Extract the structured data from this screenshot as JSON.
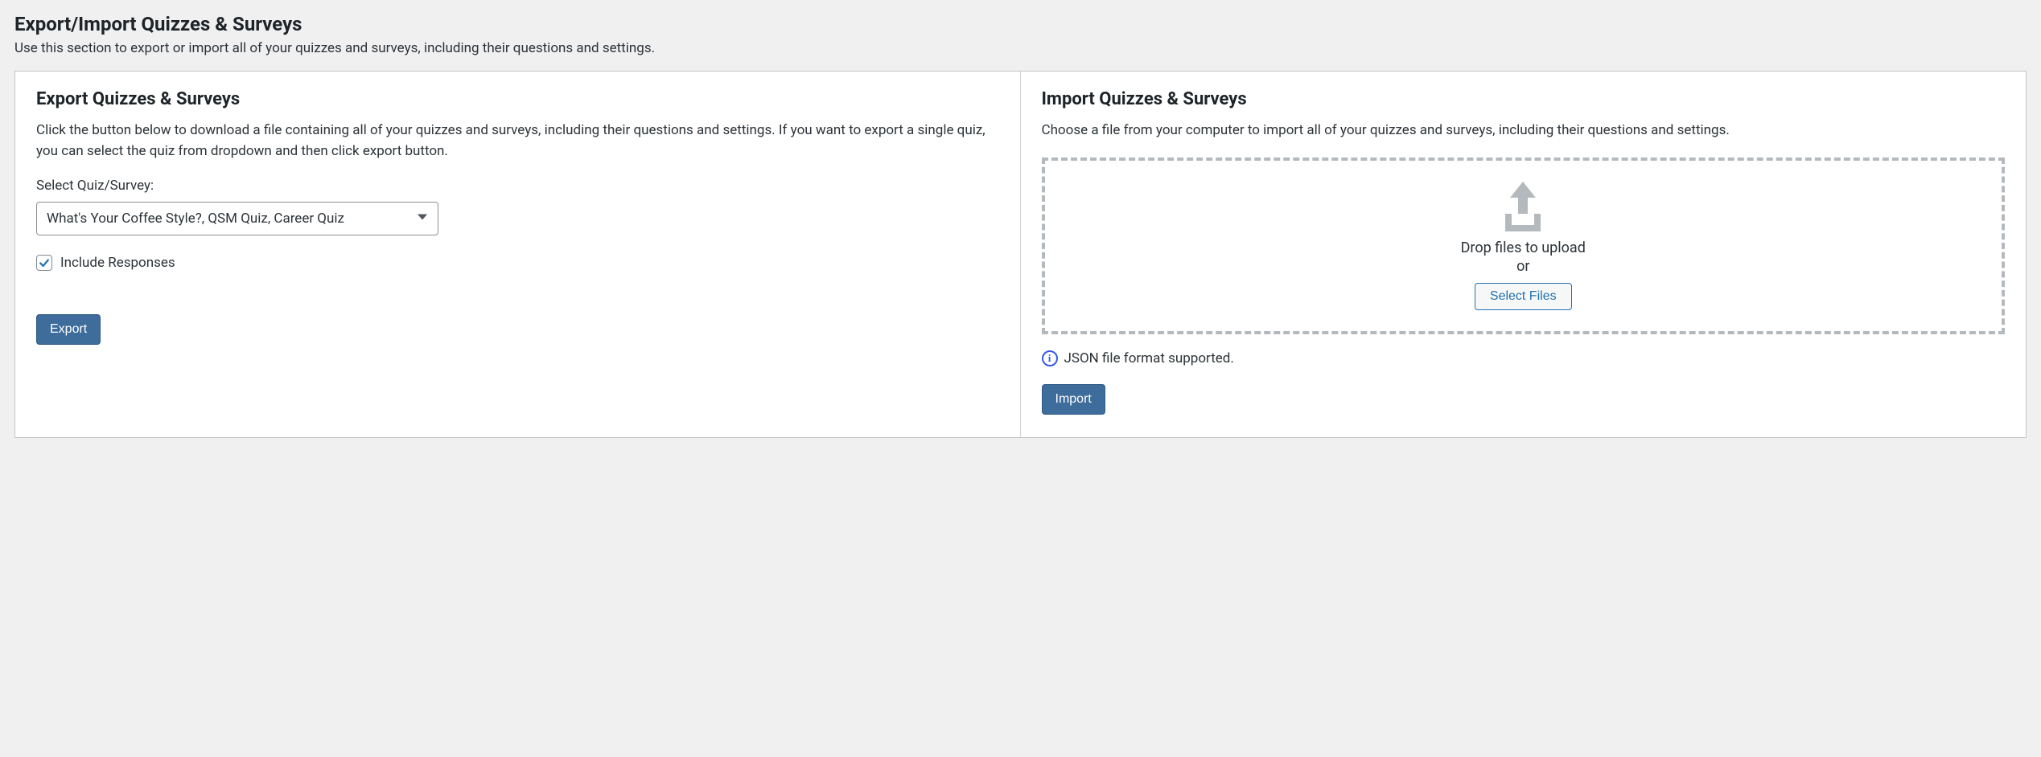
{
  "page": {
    "title": "Export/Import Quizzes & Surveys",
    "description": "Use this section to export or import all of your quizzes and surveys, including their questions and settings."
  },
  "export": {
    "title": "Export Quizzes & Surveys",
    "description": "Click the button below to download a file containing all of your quizzes and surveys, including their questions and settings. If you want to export a single quiz, you can select the quiz from dropdown and then click export button.",
    "select_label": "Select Quiz/Survey:",
    "select_value": "What's Your Coffee Style?, QSM Quiz, Career Quiz",
    "include_responses_label": "Include Responses",
    "include_responses_checked": true,
    "button_label": "Export"
  },
  "import": {
    "title": "Import Quizzes & Surveys",
    "description": "Choose a file from your computer to import all of your quizzes and surveys, including their questions and settings.",
    "dropzone": {
      "drop_text": "Drop files to upload",
      "or_text": "or",
      "select_files_label": "Select Files"
    },
    "info_text": "JSON file format supported.",
    "button_label": "Import"
  },
  "colors": {
    "primary": "#3e6c9b",
    "link": "#2271b1",
    "info": "#3858e9",
    "border_dash": "#b4b9be"
  }
}
